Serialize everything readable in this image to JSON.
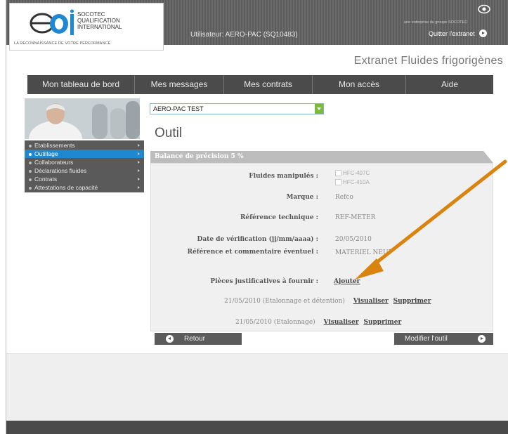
{
  "header": {
    "logo_lines": [
      "SOCOTEC",
      "QUALIFICATION",
      "INTERNATIONAL"
    ],
    "logo_tagline": "LA RECONNAISSANCE DE VOTRE PERFORMANCE",
    "user_label": "Utilisateur: AERO-PAC (SQ10483)",
    "group_text": "une entreprise du groupe SOCOTEC",
    "quit_label": "Quitter l'extranet",
    "site_title": "Extranet Fluides frigorigènes"
  },
  "menu": {
    "items": [
      "Mon tableau de bord",
      "Mes messages",
      "Mes contrats",
      "Mon accès",
      "Aide"
    ]
  },
  "sidebar": {
    "items": [
      {
        "label": "Etablissements",
        "active": false
      },
      {
        "label": "Outillage",
        "active": true
      },
      {
        "label": "Collaborateurs",
        "active": false
      },
      {
        "label": "Déclarations fluides",
        "active": false
      },
      {
        "label": "Contrats",
        "active": false
      },
      {
        "label": "Attestations de capacité",
        "active": false
      }
    ]
  },
  "company_select": {
    "value": "AERO-PAC TEST"
  },
  "page": {
    "title": "Outil"
  },
  "tool": {
    "header": "Balance de précision 5 %",
    "fluids_label": "Fluides manipulés :",
    "fluids": [
      "HFC-407C",
      "HFC-410A"
    ],
    "brand_label": "Marque :",
    "brand": "Refco",
    "ref_label": "Référence technique :",
    "ref": "REF-METER",
    "date_label": "Date de vérification (jj/mm/aaaa) :",
    "date": "20/05/2010",
    "comment_label": "Référence et commentaire éventuel :",
    "comment": "MATERIEL NEUF",
    "docs_label": "Pièces justificatives à fournir :",
    "add_link": "Ajouter",
    "documents": [
      {
        "text": "21/05/2010 (Etalonnage et détention)",
        "view": "Visualiser",
        "delete": "Supprimer"
      },
      {
        "text": "21/05/2010 (Etalonnage)",
        "view": "Visualiser",
        "delete": "Supprimer"
      }
    ]
  },
  "buttons": {
    "back": "Retour",
    "edit": "Modifier l'outil"
  },
  "colors": {
    "accent": "#1e88d0",
    "annotation_arrow": "#d9840e",
    "select_button": "#7cba3a"
  }
}
